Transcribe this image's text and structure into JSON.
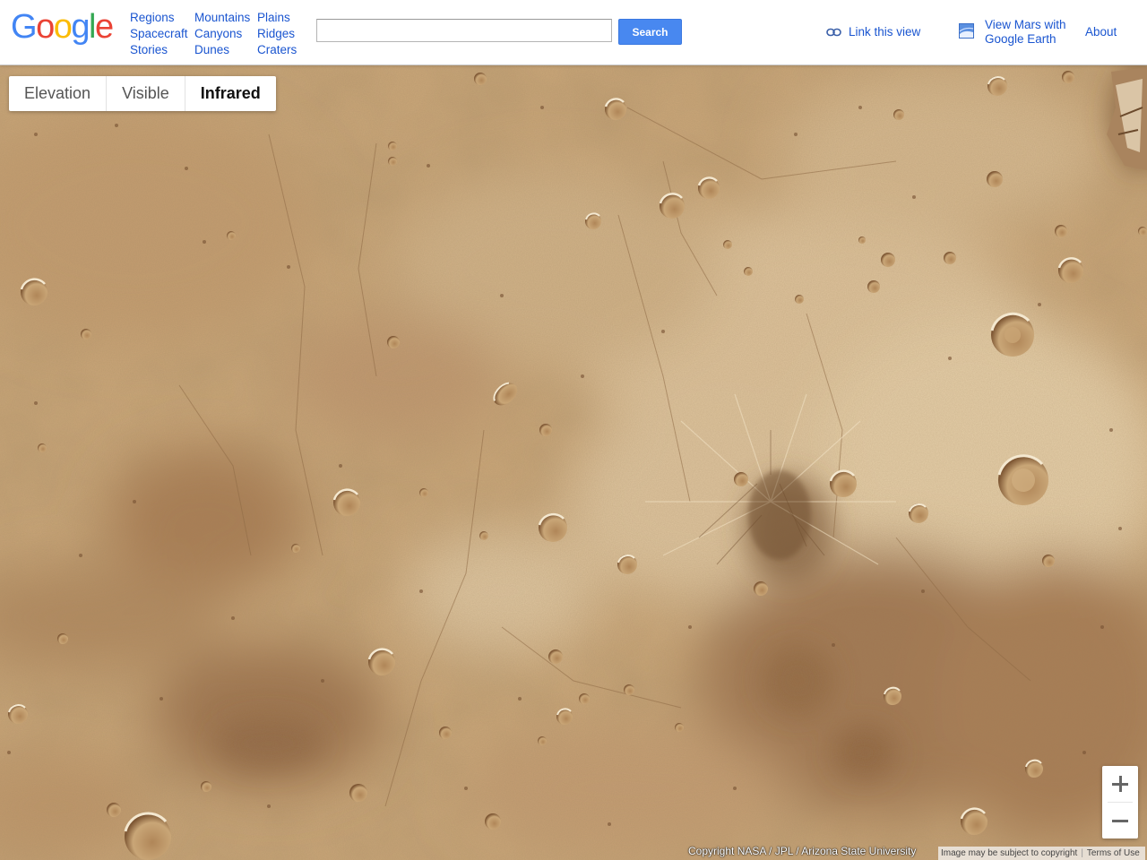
{
  "header": {
    "logo": {
      "text": "Google",
      "letters": [
        {
          "ch": "G",
          "color": "#4285F4"
        },
        {
          "ch": "o",
          "color": "#EA4335"
        },
        {
          "ch": "o",
          "color": "#FBBC05"
        },
        {
          "ch": "g",
          "color": "#4285F4"
        },
        {
          "ch": "l",
          "color": "#34A853"
        },
        {
          "ch": "e",
          "color": "#EA4335"
        }
      ]
    },
    "nav_columns": [
      [
        "Regions",
        "Spacecraft",
        "Stories"
      ],
      [
        "Mountains",
        "Canyons",
        "Dunes"
      ],
      [
        "Plains",
        "Ridges",
        "Craters"
      ]
    ],
    "search": {
      "value": "",
      "placeholder": "",
      "button_label": "Search"
    },
    "link_view_label": "Link this view",
    "earth_link_label": "View Mars with Google Earth",
    "about_label": "About"
  },
  "layer_tabs": [
    {
      "label": "Elevation",
      "active": false
    },
    {
      "label": "Visible",
      "active": false
    },
    {
      "label": "Infrared",
      "active": true
    }
  ],
  "zoom": {
    "in_icon": "plus-icon",
    "out_icon": "minus-icon"
  },
  "attribution": {
    "copyright": "Copyright NASA / JPL / Arizona State University",
    "notice": "Image may be subject to copyright",
    "terms": "Terms of Use"
  },
  "colors": {
    "link": "#1a55d0",
    "search_button": "#4888f0",
    "terrain_base": "#c8a578",
    "terrain_light": "#e9d3b0",
    "terrain_dark": "#9b7047"
  }
}
